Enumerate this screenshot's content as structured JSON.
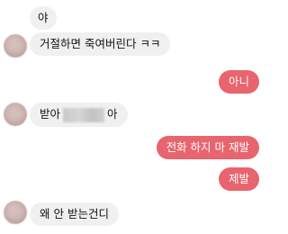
{
  "messages": [
    {
      "id": "m1",
      "sender": "other",
      "text": "야"
    },
    {
      "id": "m2",
      "sender": "other",
      "text": "거절하면 죽여버린다 ㅋㅋ"
    },
    {
      "id": "m3",
      "sender": "me",
      "text": "아니"
    },
    {
      "id": "m4",
      "sender": "other",
      "text_before": "받아",
      "text_after": "아",
      "redacted": true
    },
    {
      "id": "m5",
      "sender": "me",
      "text": "전화 하지 마 재발"
    },
    {
      "id": "m6",
      "sender": "me",
      "text": "제발"
    },
    {
      "id": "m7",
      "sender": "other",
      "text": "왜 안 받는건디"
    }
  ],
  "colors": {
    "incoming_bubble": "#f0f0f0",
    "outgoing_bubble": "#e8646e"
  },
  "icons": {
    "avatar": "avatar-icon"
  }
}
